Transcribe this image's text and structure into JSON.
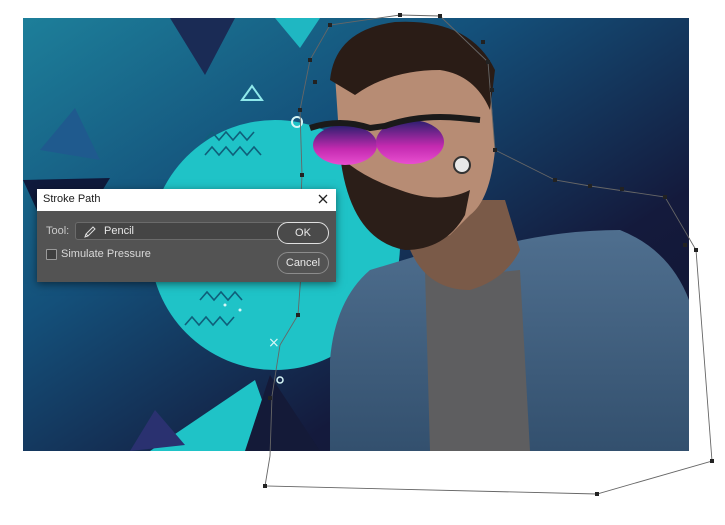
{
  "dialog": {
    "title": "Stroke Path",
    "tool_label": "Tool:",
    "tool_value": "Pencil",
    "simulate_pressure_label": "Simulate Pressure",
    "simulate_pressure_checked": false,
    "ok_label": "OK",
    "cancel_label": "Cancel"
  },
  "colors": {
    "dialog_bg": "#535353",
    "canvas_navy": "#141a38",
    "teal_accent": "#1fc3c7",
    "lens_magenta": "#c42ab0"
  }
}
